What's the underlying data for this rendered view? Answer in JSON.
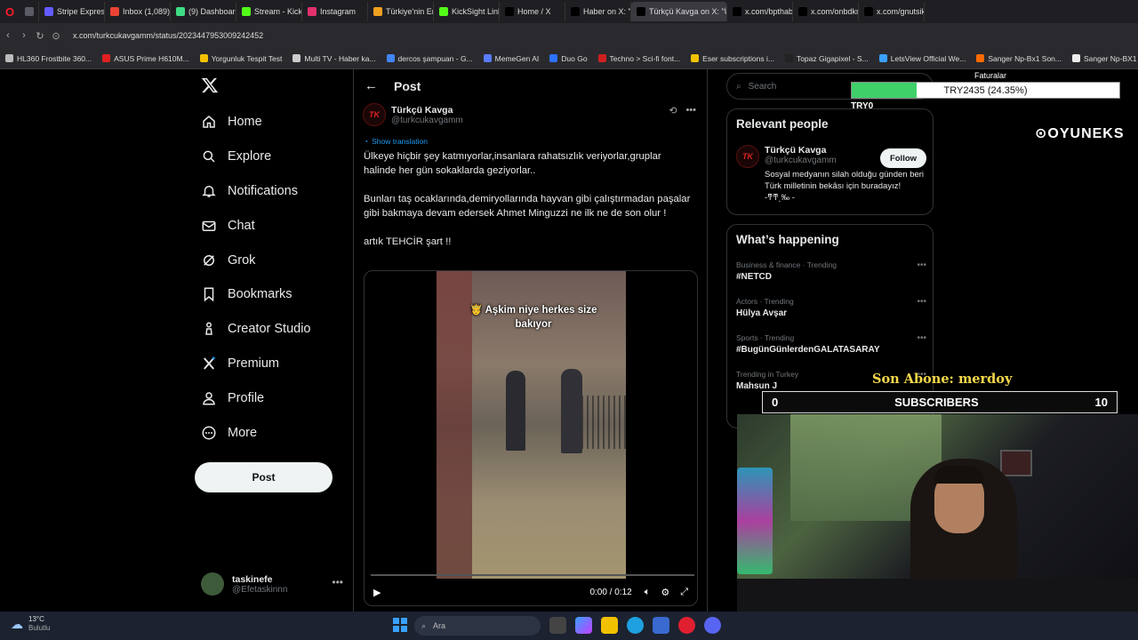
{
  "browser": {
    "tabs": [
      {
        "label": "",
        "color": "#5b5b66"
      },
      {
        "label": "Stripe Express",
        "color": "#635bff"
      },
      {
        "label": "Inbox (1,089)",
        "color": "#ea4335"
      },
      {
        "label": "(9) Dashboard",
        "color": "#3ddc84"
      },
      {
        "label": "Stream - Kick D",
        "color": "#53fc18"
      },
      {
        "label": "Instagram",
        "color": "#e1306c"
      },
      {
        "label": "Türkiye'nin En",
        "color": "#f0a020"
      },
      {
        "label": "KickSight Link",
        "color": "#53fc18"
      },
      {
        "label": "Home / X",
        "color": "#000000"
      },
      {
        "label": "Haber on X: \"A",
        "color": "#000000"
      },
      {
        "label": "Türkçü Kavga on X: \"Ülke",
        "color": "#000000",
        "active": true
      },
      {
        "label": "x.com/bpthabe",
        "color": "#000000"
      },
      {
        "label": "x.com/onbdkr",
        "color": "#000000"
      },
      {
        "label": "x.com/gnutsik",
        "color": "#000000"
      }
    ],
    "url": "x.com/turkcukavgamm/status/2023447953009242452",
    "bookmarks": [
      {
        "label": "HL360 Frostbite 360...",
        "color": "#bbbbbb"
      },
      {
        "label": "ASUS Prime H610M...",
        "color": "#e02020"
      },
      {
        "label": "Yorgunluk Tespit Test",
        "color": "#f2c200"
      },
      {
        "label": "Multi TV - Haber ka...",
        "color": "#cccccc"
      },
      {
        "label": "dercos şampuan - G...",
        "color": "#4285f4"
      },
      {
        "label": "MemeGen AI",
        "color": "#5a7cff"
      },
      {
        "label": "Duo Go",
        "color": "#2d72ff"
      },
      {
        "label": "Techno > Sci-fi font...",
        "color": "#d02020"
      },
      {
        "label": "Eser subscriptions i...",
        "color": "#f2c200"
      },
      {
        "label": "Topaz Gigapixel - S...",
        "color": "#222222"
      },
      {
        "label": "LetsView Official We...",
        "color": "#3aa0ff"
      },
      {
        "label": "Sanger Np-Bx1 Son...",
        "color": "#ff6a00"
      },
      {
        "label": "Sanger Np-BX1 Son...",
        "color": "#eeeeee"
      }
    ]
  },
  "nav": {
    "items": [
      {
        "label": "Home",
        "icon": "home-icon"
      },
      {
        "label": "Explore",
        "icon": "search-icon"
      },
      {
        "label": "Notifications",
        "icon": "bell-icon"
      },
      {
        "label": "Chat",
        "icon": "mail-icon"
      },
      {
        "label": "Grok",
        "icon": "grok-icon"
      },
      {
        "label": "Bookmarks",
        "icon": "bookmark-icon"
      },
      {
        "label": "Creator Studio",
        "icon": "creator-icon"
      },
      {
        "label": "Premium",
        "icon": "x-premium-icon"
      },
      {
        "label": "Profile",
        "icon": "person-icon"
      },
      {
        "label": "More",
        "icon": "more-circle-icon"
      }
    ],
    "post_button": "Post",
    "account": {
      "name": "taskinefe",
      "handle": "@Efetaskinnn"
    }
  },
  "main": {
    "header": "Post",
    "author": {
      "name": "Türkçü Kavga",
      "handle": "@turkcukavgamm",
      "avatar_text": "TK"
    },
    "show_translation": "Show translation",
    "paragraphs": [
      "Ülkeye hiçbir şey katmıyorlar,insanlara rahatsızlık veriyorlar,gruplar halinde her gün sokaklarda geziyorlar..",
      "Bunları taş ocaklarında,demiryollarında hayvan gibi çalıştırmadan paşalar gibi bakmaya devam edersek Ahmet Minguzzi ne ilk ne de son olur !",
      "artık TEHCİR  şart !!"
    ],
    "video": {
      "caption": "🤴 Aşkim niye herkes size bakıyor",
      "time": "0:00 / 0:12",
      "progress": 0
    }
  },
  "sidebar": {
    "search_placeholder": "Search",
    "relevant_title": "Relevant people",
    "person": {
      "name": "Türkçü Kavga",
      "handle": "@turkcukavgamm",
      "bio": "Sosyal medyanın silah olduğu günden beri Türk milletinin bekâsı için buradayız! -ͳͳ͵‰ -",
      "follow": "Follow"
    },
    "happening_title": "What’s happening",
    "trends": [
      {
        "meta": "Business & finance · Trending",
        "topic": "#NETCD"
      },
      {
        "meta": "Actors · Trending",
        "topic": "Hülya Avşar"
      },
      {
        "meta": "Sports · Trending",
        "topic": "#BugünGünlerdenGALATASARAY"
      },
      {
        "meta": "Trending in Turkey",
        "topic": "Mahsun J"
      }
    ]
  },
  "overlay": {
    "goal_title": "Faturalar",
    "goal_text": "TRY2435 (24.35%)",
    "goal_fraction": 0.2435,
    "goal_label": "TRY0",
    "brand": "OYUNEKS",
    "son_abone": "Son Abone: merdoy",
    "subs_left": "0",
    "subs_label": "SUBSCRIBERS",
    "subs_right": "10"
  },
  "taskbar": {
    "temp": "13°C",
    "weather": "Bulutlu",
    "search": "Ara"
  }
}
